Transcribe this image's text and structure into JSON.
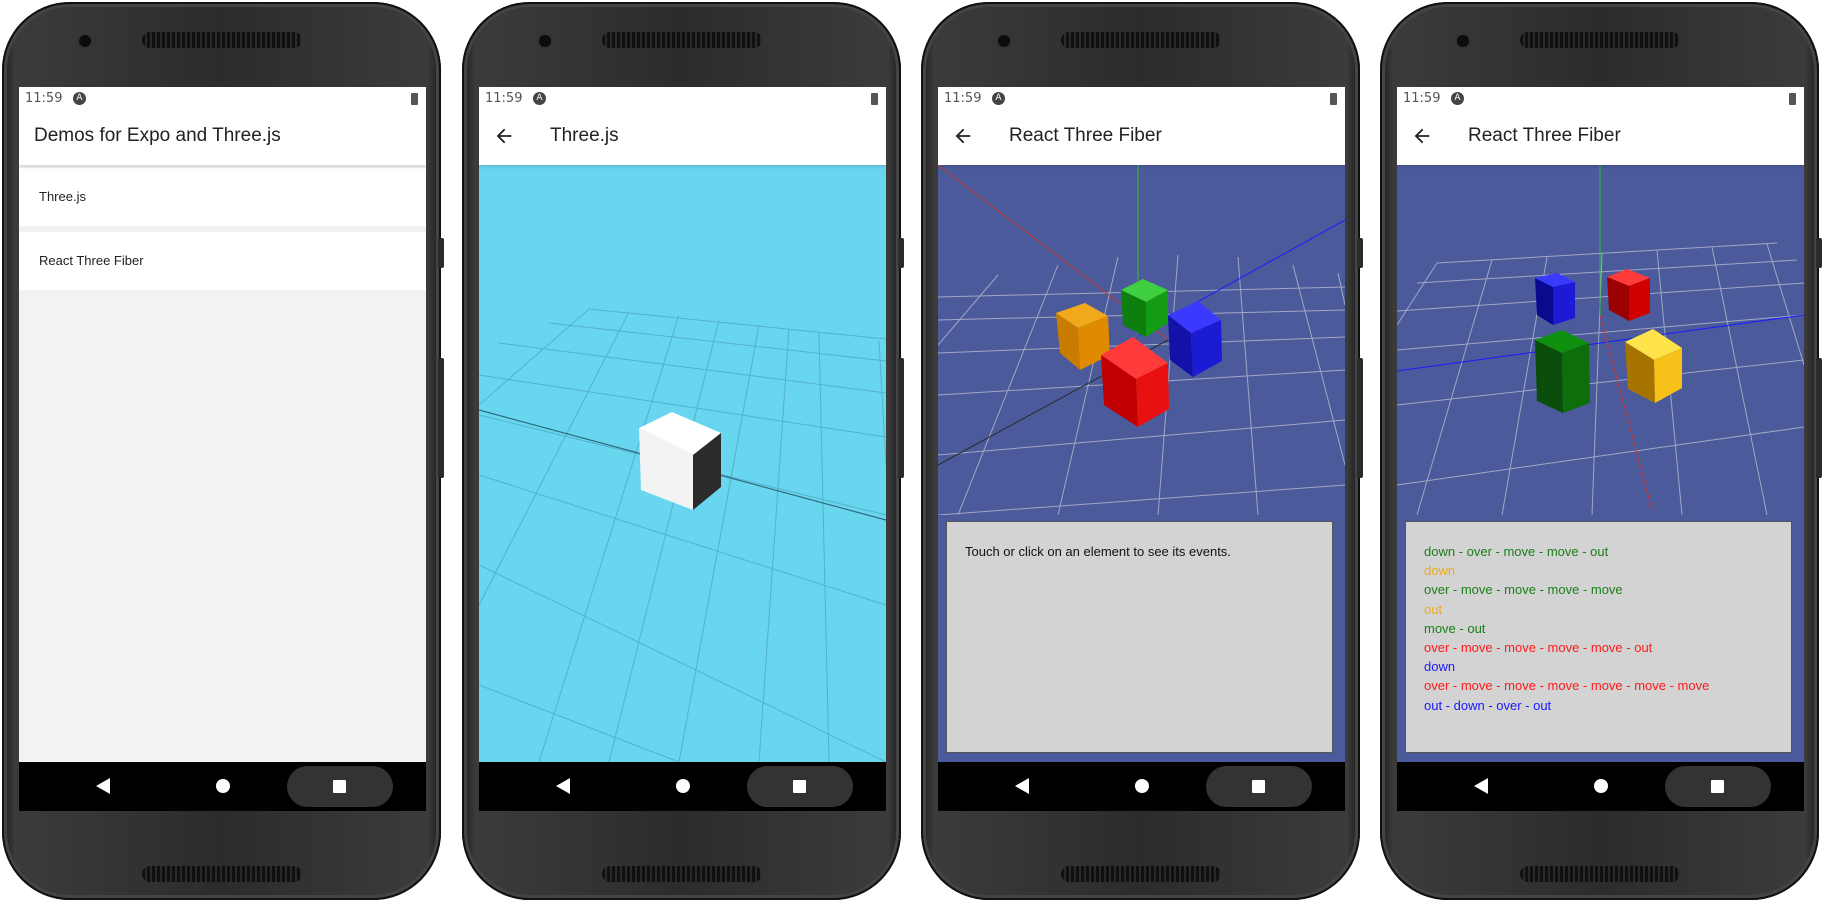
{
  "status": {
    "time": "11:59",
    "indicator": "A"
  },
  "screens": [
    {
      "title": "Demos for Expo and Three.js",
      "list": [
        "Three.js",
        "React Three Fiber"
      ]
    },
    {
      "title": "Three.js"
    },
    {
      "title": "React Three Fiber",
      "message": "Touch or click on an element to see its events."
    },
    {
      "title": "React Three Fiber",
      "events": [
        {
          "text": "down - over - move - move - out",
          "color": "#1a7f1a"
        },
        {
          "text": "down",
          "color": "#f2a81d"
        },
        {
          "text": "over - move - move - move - move",
          "color": "#1a7f1a"
        },
        {
          "text": "out",
          "color": "#f2a81d"
        },
        {
          "text": "move - out",
          "color": "#1a7f1a"
        },
        {
          "text": "over - move - move - move - move - out",
          "color": "#ff1a1a"
        },
        {
          "text": "down",
          "color": "#1a1aff"
        },
        {
          "text": "over - move - move - move - move - move - move",
          "color": "#ff1a1a"
        },
        {
          "text": "out - down - over - out",
          "color": "#1a1aff"
        }
      ]
    }
  ],
  "colors": {
    "threejs_bg": "#69d6ef",
    "r3f_bg": "#4b5a9b",
    "cube_orange": "#e08a00",
    "cube_green": "#159c15",
    "cube_blue": "#1b1bd6",
    "cube_red": "#e81010",
    "cube_yellow": "#f6c21a"
  }
}
